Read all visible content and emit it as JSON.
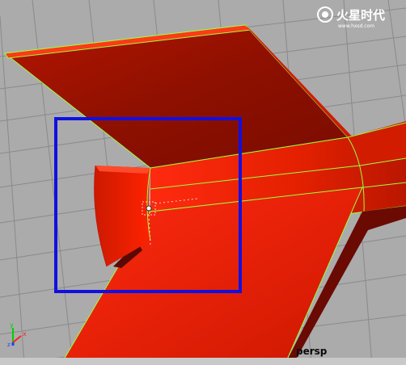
{
  "viewport": {
    "camera": "persp",
    "tool": "move",
    "axes": {
      "x": "x",
      "y": "y",
      "z": "z"
    }
  },
  "watermark": {
    "logo": "火星时代",
    "url": "www.hxsd.com"
  },
  "colors": {
    "background": "#ababab",
    "grid": "#8a8a8a",
    "mesh": "#e02000",
    "wire": "#9cff3a",
    "selection_box": "#1010e0",
    "manipulator": "#ffffff"
  }
}
